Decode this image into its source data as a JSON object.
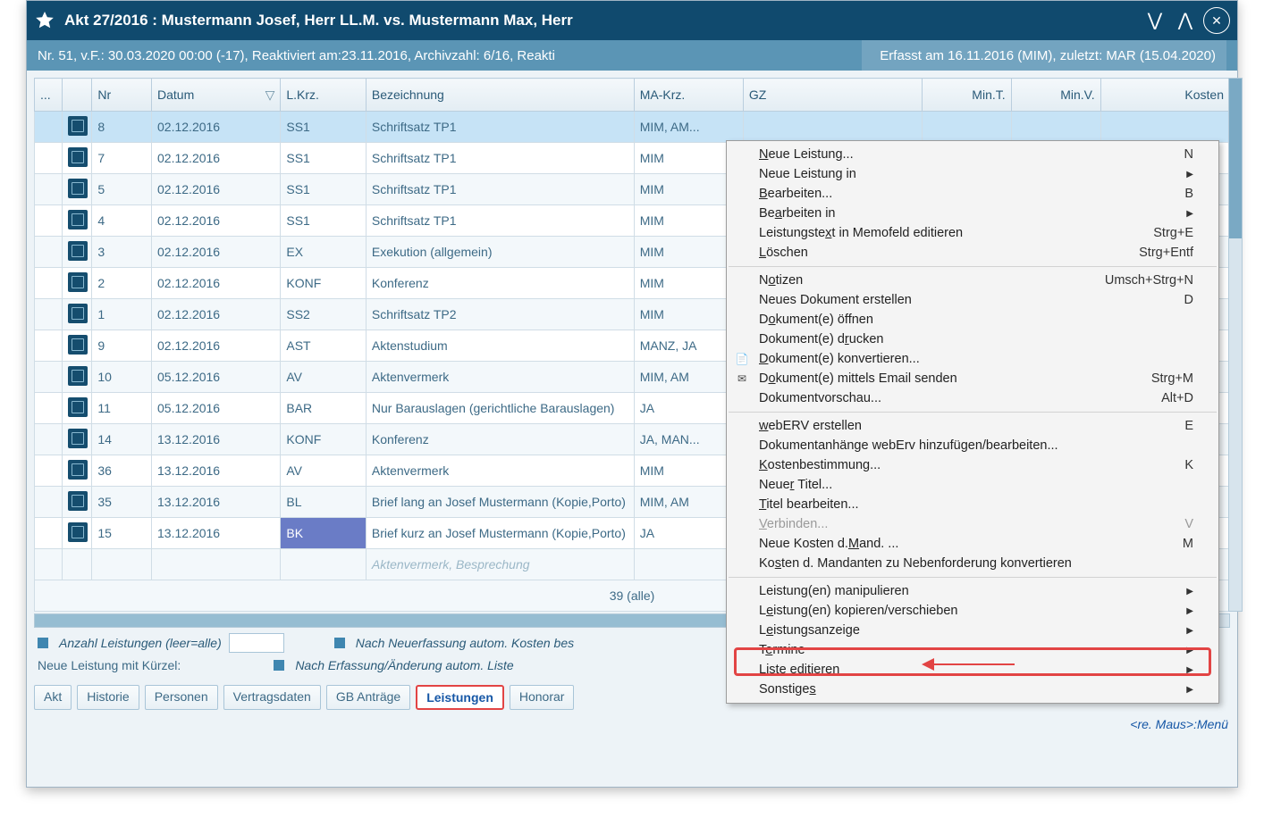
{
  "window": {
    "title": "Akt 27/2016 : Mustermann Josef, Herr  LL.M. vs. Mustermann Max, Herr"
  },
  "subbar": {
    "left": "Nr. 51, v.F.: 30.03.2020 00:00 (-17), Reaktiviert am:23.11.2016, Archivzahl: 6/16, Reakti",
    "right": "Erfasst am 16.11.2016 (MIM), zuletzt: MAR (15.04.2020)"
  },
  "columns": {
    "config": "...",
    "nr": "Nr",
    "datum": "Datum",
    "lkrz": "L.Krz.",
    "bez": "Bezeichnung",
    "makrz": "MA-Krz.",
    "gz": "GZ",
    "mint": "Min.T.",
    "minv": "Min.V.",
    "kosten": "Kosten"
  },
  "rows": [
    {
      "nr": "8",
      "datum": "02.12.2016",
      "lkrz": "SS1",
      "bez": "Schriftsatz TP1",
      "makrz": "MIM, AM..."
    },
    {
      "nr": "7",
      "datum": "02.12.2016",
      "lkrz": "SS1",
      "bez": "Schriftsatz TP1",
      "makrz": "MIM"
    },
    {
      "nr": "5",
      "datum": "02.12.2016",
      "lkrz": "SS1",
      "bez": "Schriftsatz TP1",
      "makrz": "MIM"
    },
    {
      "nr": "4",
      "datum": "02.12.2016",
      "lkrz": "SS1",
      "bez": "Schriftsatz TP1",
      "makrz": "MIM"
    },
    {
      "nr": "3",
      "datum": "02.12.2016",
      "lkrz": "EX",
      "bez": "Exekution (allgemein)",
      "makrz": "MIM"
    },
    {
      "nr": "2",
      "datum": "02.12.2016",
      "lkrz": "KONF",
      "bez": "Konferenz",
      "makrz": "MIM"
    },
    {
      "nr": "1",
      "datum": "02.12.2016",
      "lkrz": "SS2",
      "bez": "Schriftsatz TP2",
      "makrz": "MIM"
    },
    {
      "nr": "9",
      "datum": "02.12.2016",
      "lkrz": "AST",
      "bez": "Aktenstudium",
      "makrz": "MANZ, JA"
    },
    {
      "nr": "10",
      "datum": "05.12.2016",
      "lkrz": "AV",
      "bez": "Aktenvermerk",
      "makrz": "MIM, AM"
    },
    {
      "nr": "11",
      "datum": "05.12.2016",
      "lkrz": "BAR",
      "bez": "Nur Barauslagen (gerichtliche Barauslagen)",
      "makrz": "JA"
    },
    {
      "nr": "14",
      "datum": "13.12.2016",
      "lkrz": "KONF",
      "bez": "Konferenz",
      "makrz": "JA, MAN..."
    },
    {
      "nr": "36",
      "datum": "13.12.2016",
      "lkrz": "AV",
      "bez": "Aktenvermerk",
      "makrz": "MIM"
    },
    {
      "nr": "35",
      "datum": "13.12.2016",
      "lkrz": "BL",
      "bez": "Brief lang an Josef Mustermann (Kopie,Porto)",
      "makrz": "MIM, AM"
    },
    {
      "nr": "15",
      "datum": "13.12.2016",
      "lkrz": "BK",
      "bez": "Brief kurz an Josef Mustermann (Kopie,Porto)",
      "makrz": "JA"
    }
  ],
  "cutoff_row": "Aktenvermerk, Besprechung",
  "summary": "39 (alle)",
  "options": {
    "anzahl": "Anzahl Leistungen (leer=alle)",
    "neue": "Neue Leistung mit Kürzel:",
    "nach1": "Nach Neuerfassung autom. Kosten bes",
    "nach2": "Nach Erfassung/Änderung autom. Liste"
  },
  "tabs": {
    "akt": "Akt",
    "historie": "Historie",
    "personen": "Personen",
    "vertrags": "Vertragsdaten",
    "gb": "GB Anträge",
    "leistungen": "Leistungen",
    "honorar": "Honorar"
  },
  "hint": "<re. Maus>:Menü",
  "menu": {
    "neue": "Neue Leistung...",
    "neue_sc": "N",
    "neuein": "Neue Leistung in",
    "bearb": "Bearbeiten...",
    "bearb_sc": "B",
    "bearbin": "Bearbeiten in",
    "memo": "Leistungstext in Memofeld editieren",
    "memo_sc": "Strg+E",
    "loeschen": "Löschen",
    "loeschen_sc": "Strg+Entf",
    "notizen": "Notizen",
    "notizen_sc": "Umsch+Strg+N",
    "neudok": "Neues Dokument erstellen",
    "neudok_sc": "D",
    "dokoeff": "Dokument(e) öffnen",
    "dokdruck": "Dokument(e) drucken",
    "dokkonv": "Dokument(e) konvertieren...",
    "dokmail": "Dokument(e) mittels Email senden",
    "dokmail_sc": "Strg+M",
    "dokvor": "Dokumentvorschau...",
    "dokvor_sc": "Alt+D",
    "weberv": "webERV erstellen",
    "weberv_sc": "E",
    "dokanh": "Dokumentanhänge webErv hinzufügen/bearbeiten...",
    "kostenb": "Kostenbestimmung...",
    "kostenb_sc": "K",
    "neutitel": "Neuer Titel...",
    "titelb": "Titel bearbeiten...",
    "verbinden": "Verbinden...",
    "verbinden_sc": "V",
    "neukost": "Neue Kosten d.Mand. ...",
    "neukost_sc": "M",
    "kostkonv": "Kosten d. Mandanten zu Nebenforderung konvertieren",
    "manip": "Leistung(en) manipulieren",
    "kopver": "Leistung(en) kopieren/verschieben",
    "leistanz": "Leistungsanzeige",
    "termine": "Termine",
    "liste": "Liste editieren",
    "sonst": "Sonstiges"
  }
}
